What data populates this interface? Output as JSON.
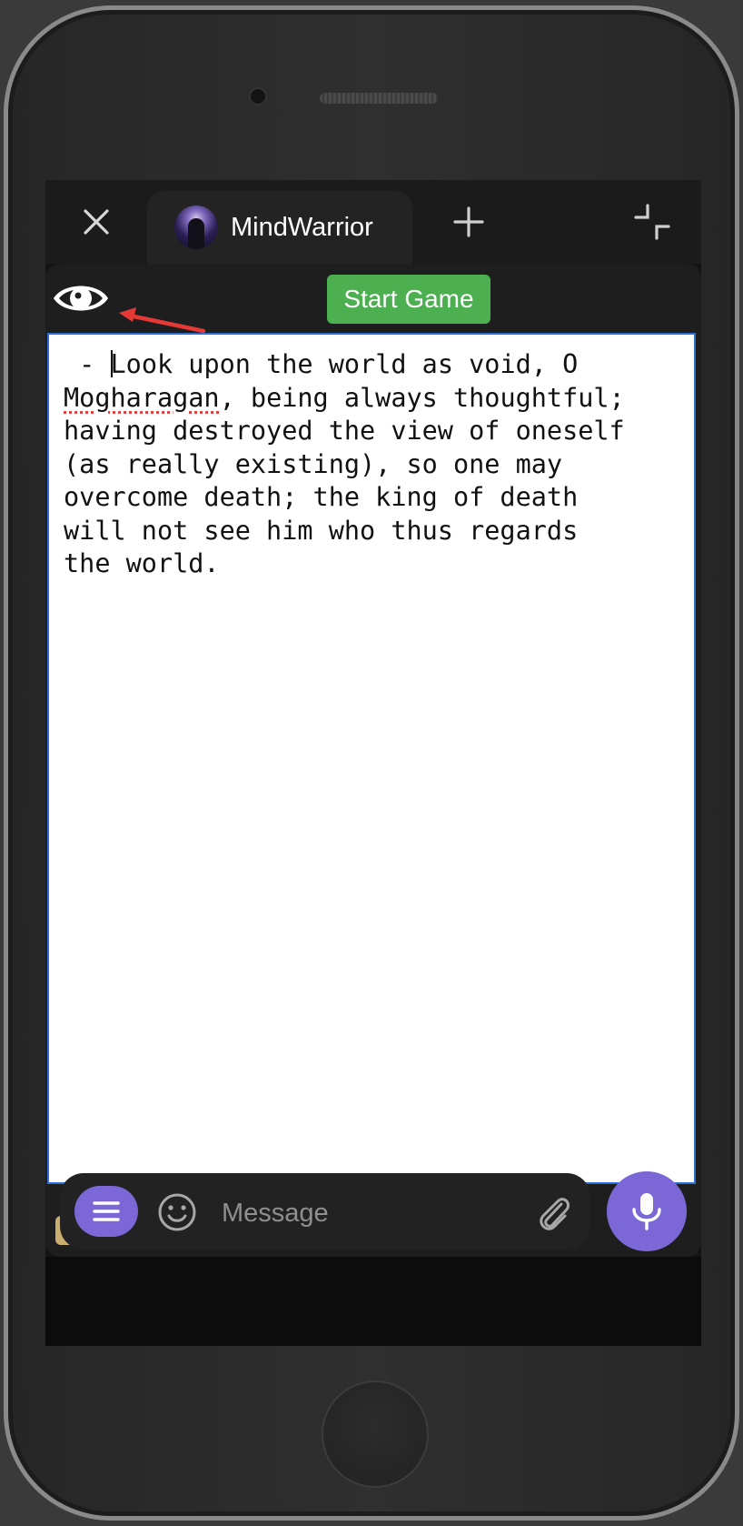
{
  "tabbar": {
    "title": "MindWarrior",
    "close_icon": "close-icon",
    "add_icon": "plus-icon",
    "minimize_icon": "minimize-icon"
  },
  "toolbar": {
    "start_game_label": "Start Game",
    "eye_icon": "eye-icon",
    "annotation_arrow_color": "#e53935",
    "start_game_color": "#4caf50"
  },
  "editor": {
    "line1_prefix": " - ",
    "line1_rest": "Look upon the world as void, O\n",
    "misspelled_word": "Mogharagan",
    "body_rest": ", being always thoughtful;\nhaving destroyed the view of oneself\n(as really existing), so one may\novercome death; the king of death\nwill not see him who thus regards\nthe world."
  },
  "footer": {
    "lock_icon": "lock-icon",
    "share_icon": "share-icon"
  },
  "composer": {
    "placeholder": "Message",
    "menu_icon": "menu-icon",
    "emoji_icon": "emoji-icon",
    "attach_icon": "paperclip-icon",
    "mic_icon": "microphone-icon",
    "accent_color": "#7b68d6"
  }
}
